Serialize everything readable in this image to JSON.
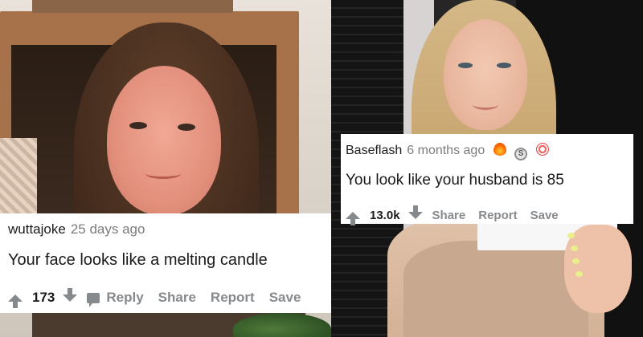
{
  "left_post": {
    "username": "wuttajoke",
    "time": "25 days ago",
    "comment": "Your face looks like a melting candle",
    "score": "173",
    "actions": [
      "Reply",
      "Share",
      "Report",
      "Save"
    ]
  },
  "right_post": {
    "username": "Baseflash",
    "time": "6 months ago",
    "comment": "You look like your husband is 85",
    "score": "13.0k",
    "actions": [
      "Share",
      "Report",
      "Save"
    ],
    "awards": [
      "fire-award-icon",
      "silver-award-icon",
      "flower-award-icon"
    ]
  },
  "colors": {
    "action_gray": "#878a8c",
    "text_dark": "#1a1a1b",
    "meta_gray": "#7c7c7c",
    "card_bg": "#ffffff"
  }
}
